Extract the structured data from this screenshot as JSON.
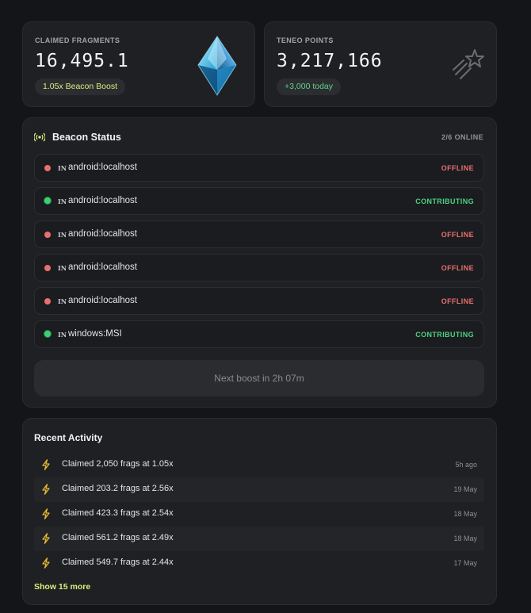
{
  "stats": {
    "fragments": {
      "label": "CLAIMED FRAGMENTS",
      "value": "16,495.1",
      "pill": "1.05x Beacon Boost",
      "icon": "crystal-icon"
    },
    "points": {
      "label": "TENEO POINTS",
      "value": "3,217,166",
      "pill": "+3,000 today",
      "icon": "shooting-star-icon"
    }
  },
  "beacon": {
    "title": "Beacon Status",
    "online_count": "2/6 ONLINE",
    "icon": "broadcast-icon",
    "rows": [
      {
        "tag": "IN",
        "device": "android:localhost",
        "status": "OFFLINE"
      },
      {
        "tag": "IN",
        "device": "android:localhost",
        "status": "CONTRIBUTING"
      },
      {
        "tag": "IN",
        "device": "android:localhost",
        "status": "OFFLINE"
      },
      {
        "tag": "IN",
        "device": "android:localhost",
        "status": "OFFLINE"
      },
      {
        "tag": "IN",
        "device": "android:localhost",
        "status": "OFFLINE"
      },
      {
        "tag": "IN",
        "device": "windows:MSI",
        "status": "CONTRIBUTING"
      }
    ],
    "next_boost": "Next boost in 2h 07m"
  },
  "activity": {
    "title": "Recent Activity",
    "items": [
      {
        "text": "Claimed 2,050 frags at 1.05x",
        "time": "5h ago"
      },
      {
        "text": "Claimed 203.2 frags at 2.56x",
        "time": "19 May"
      },
      {
        "text": "Claimed 423.3 frags at 2.54x",
        "time": "18 May"
      },
      {
        "text": "Claimed 561.2 frags at 2.49x",
        "time": "18 May"
      },
      {
        "text": "Claimed 549.7 frags at 2.44x",
        "time": "17 May"
      }
    ],
    "show_more": "Show 15 more"
  },
  "colors": {
    "accent": "#d8f07a",
    "online": "#3fcf72",
    "offline": "#e7706e",
    "bolt": "#e8b830"
  }
}
